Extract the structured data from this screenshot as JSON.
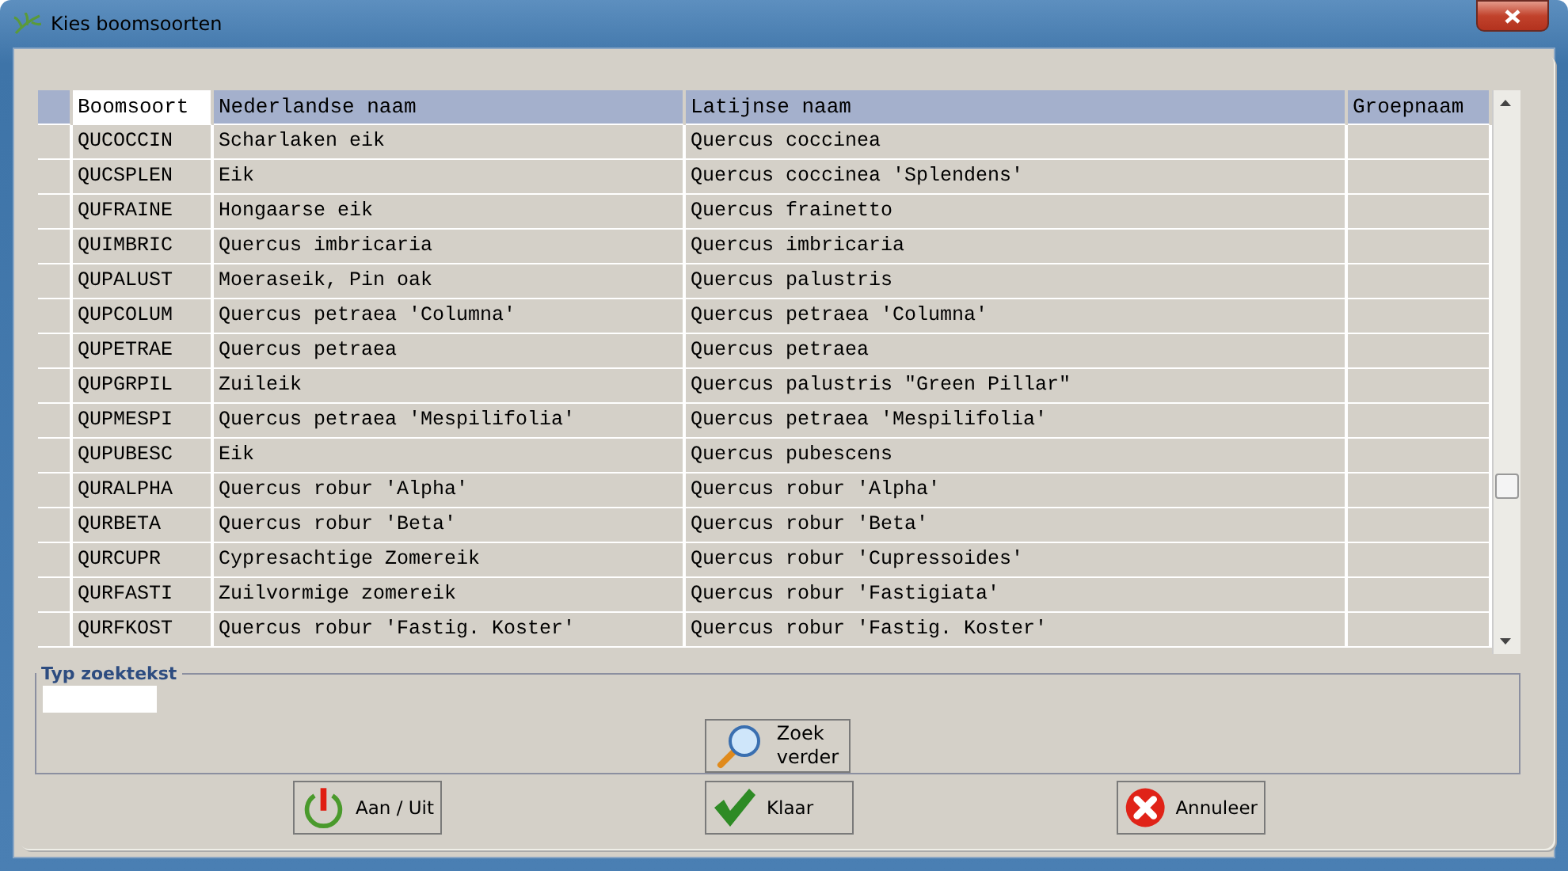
{
  "window": {
    "title": "Kies boomsoorten"
  },
  "table": {
    "columns": [
      {
        "label": "Boomsoort",
        "selected": true
      },
      {
        "label": "Nederlandse naam",
        "selected": false
      },
      {
        "label": "Latijnse naam",
        "selected": false
      },
      {
        "label": "Groepnaam",
        "selected": false
      }
    ],
    "rows": [
      [
        "QUCOCCIN",
        "Scharlaken eik",
        "Quercus coccinea"
      ],
      [
        "QUCSPLEN",
        "Eik",
        "Quercus coccinea 'Splendens'"
      ],
      [
        "QUFRAINE",
        "Hongaarse eik",
        "Quercus frainetto"
      ],
      [
        "QUIMBRIC",
        "Quercus imbricaria",
        "Quercus imbricaria"
      ],
      [
        "QUPALUST",
        "Moeraseik, Pin oak",
        "Quercus palustris"
      ],
      [
        "QUPCOLUM",
        "Quercus petraea 'Columna'",
        "Quercus petraea 'Columna'"
      ],
      [
        "QUPETRAE",
        "Quercus petraea",
        "Quercus petraea"
      ],
      [
        "QUPGRPIL",
        "Zuileik",
        "Quercus palustris \"Green Pillar\""
      ],
      [
        "QUPMESPI",
        "Quercus petraea 'Mespilifolia'",
        "Quercus petraea 'Mespilifolia'"
      ],
      [
        "QUPUBESC",
        "Eik",
        "Quercus pubescens"
      ],
      [
        "QURALPHA",
        "Quercus robur 'Alpha'",
        "Quercus robur 'Alpha'"
      ],
      [
        "QURBETA",
        "Quercus robur 'Beta'",
        "Quercus robur 'Beta'"
      ],
      [
        "QURCUPR",
        "Cypresachtige Zomereik",
        "Quercus robur 'Cupressoides'"
      ],
      [
        "QURFASTI",
        "Zuilvormige zomereik",
        "Quercus robur 'Fastigiata'"
      ],
      [
        "QURFKOST",
        "Quercus robur 'Fastig. Koster'",
        "Quercus robur 'Fastig. Koster'"
      ]
    ]
  },
  "search": {
    "label": "Typ zoektekst",
    "button": "Zoek\nverder"
  },
  "buttons": [
    {
      "kind": "power",
      "label": "Aan / Uit"
    },
    {
      "kind": "check",
      "label": "Klaar"
    },
    {
      "kind": "cancel",
      "label": "Annuleer"
    }
  ]
}
